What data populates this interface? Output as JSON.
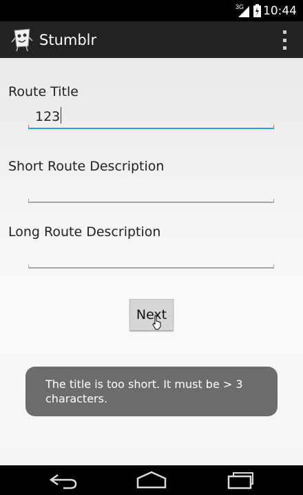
{
  "status_bar": {
    "network_label": "3G",
    "time": "10:44"
  },
  "action_bar": {
    "app_title": "Stumblr",
    "app_icon": "stumblr-app-icon",
    "overflow_icon": "overflow-menu-icon"
  },
  "form": {
    "route_title_label": "Route Title",
    "route_title_value": "123",
    "short_description_label": "Short Route Description",
    "short_description_value": "",
    "long_description_label": "Long Route Description",
    "long_description_value": "",
    "next_label": "Next"
  },
  "toast": {
    "message": "The title is too short. It must be > 3 characters."
  },
  "nav_bar": {
    "back_icon": "back-icon",
    "home_icon": "home-icon",
    "recents_icon": "recents-icon"
  },
  "colors": {
    "focus_accent": "#1da7d8",
    "action_bar": "#222222",
    "toast_background": "#646464"
  }
}
